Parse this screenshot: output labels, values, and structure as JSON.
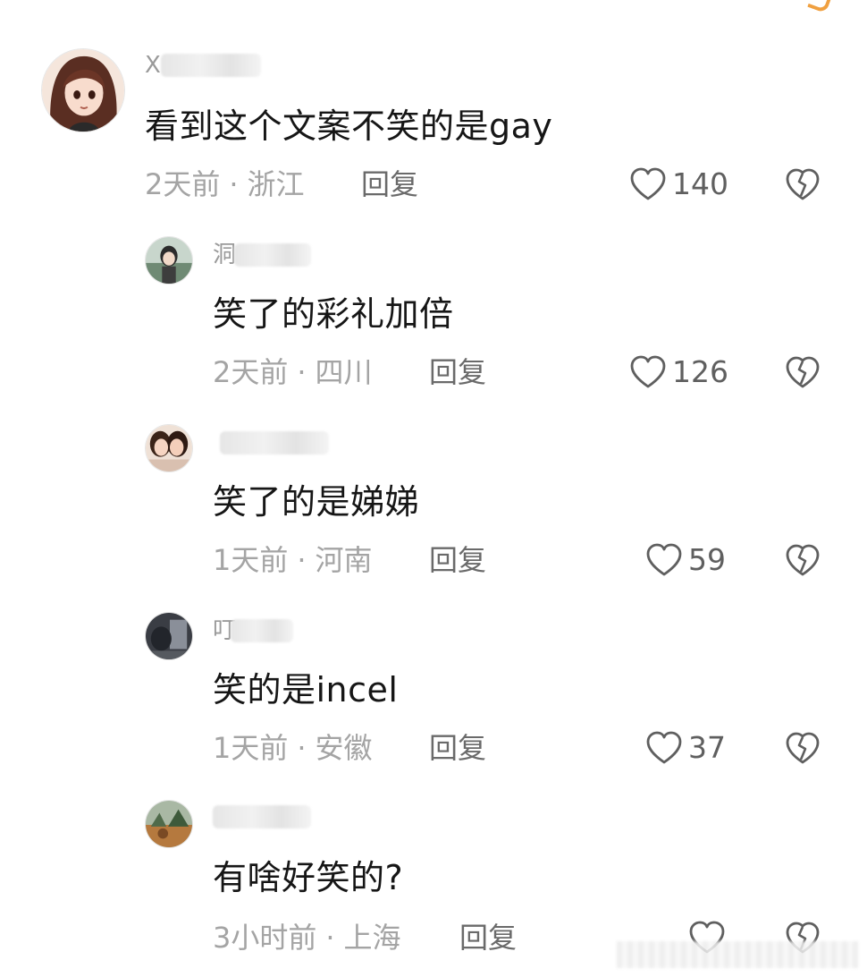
{
  "comments": [
    {
      "username": "X",
      "text": "看到这个文案不笑的是gay",
      "time": "2天前",
      "location": "浙江",
      "reply_label": "回复",
      "likes": "140"
    },
    {
      "username": "洞",
      "text": "笑了的彩礼加倍",
      "time": "2天前",
      "location": "四川",
      "reply_label": "回复",
      "likes": "126"
    },
    {
      "username": "",
      "text": "笑了的是娣娣",
      "time": "1天前",
      "location": "河南",
      "reply_label": "回复",
      "likes": "59"
    },
    {
      "username": "叮",
      "text": "笑的是incel",
      "time": "1天前",
      "location": "安徽",
      "reply_label": "回复",
      "likes": "37"
    },
    {
      "username": "",
      "text": "有啥好笑的?",
      "time": "3小时前",
      "location": "上海",
      "reply_label": "回复",
      "likes": ""
    }
  ],
  "colors": {
    "background": "#ffffff",
    "text": "#161616",
    "meta": "#a4a4a4",
    "icon": "#5f5f5f"
  },
  "icons": {
    "like": "heart-outline-icon",
    "dislike": "broken-heart-icon"
  }
}
